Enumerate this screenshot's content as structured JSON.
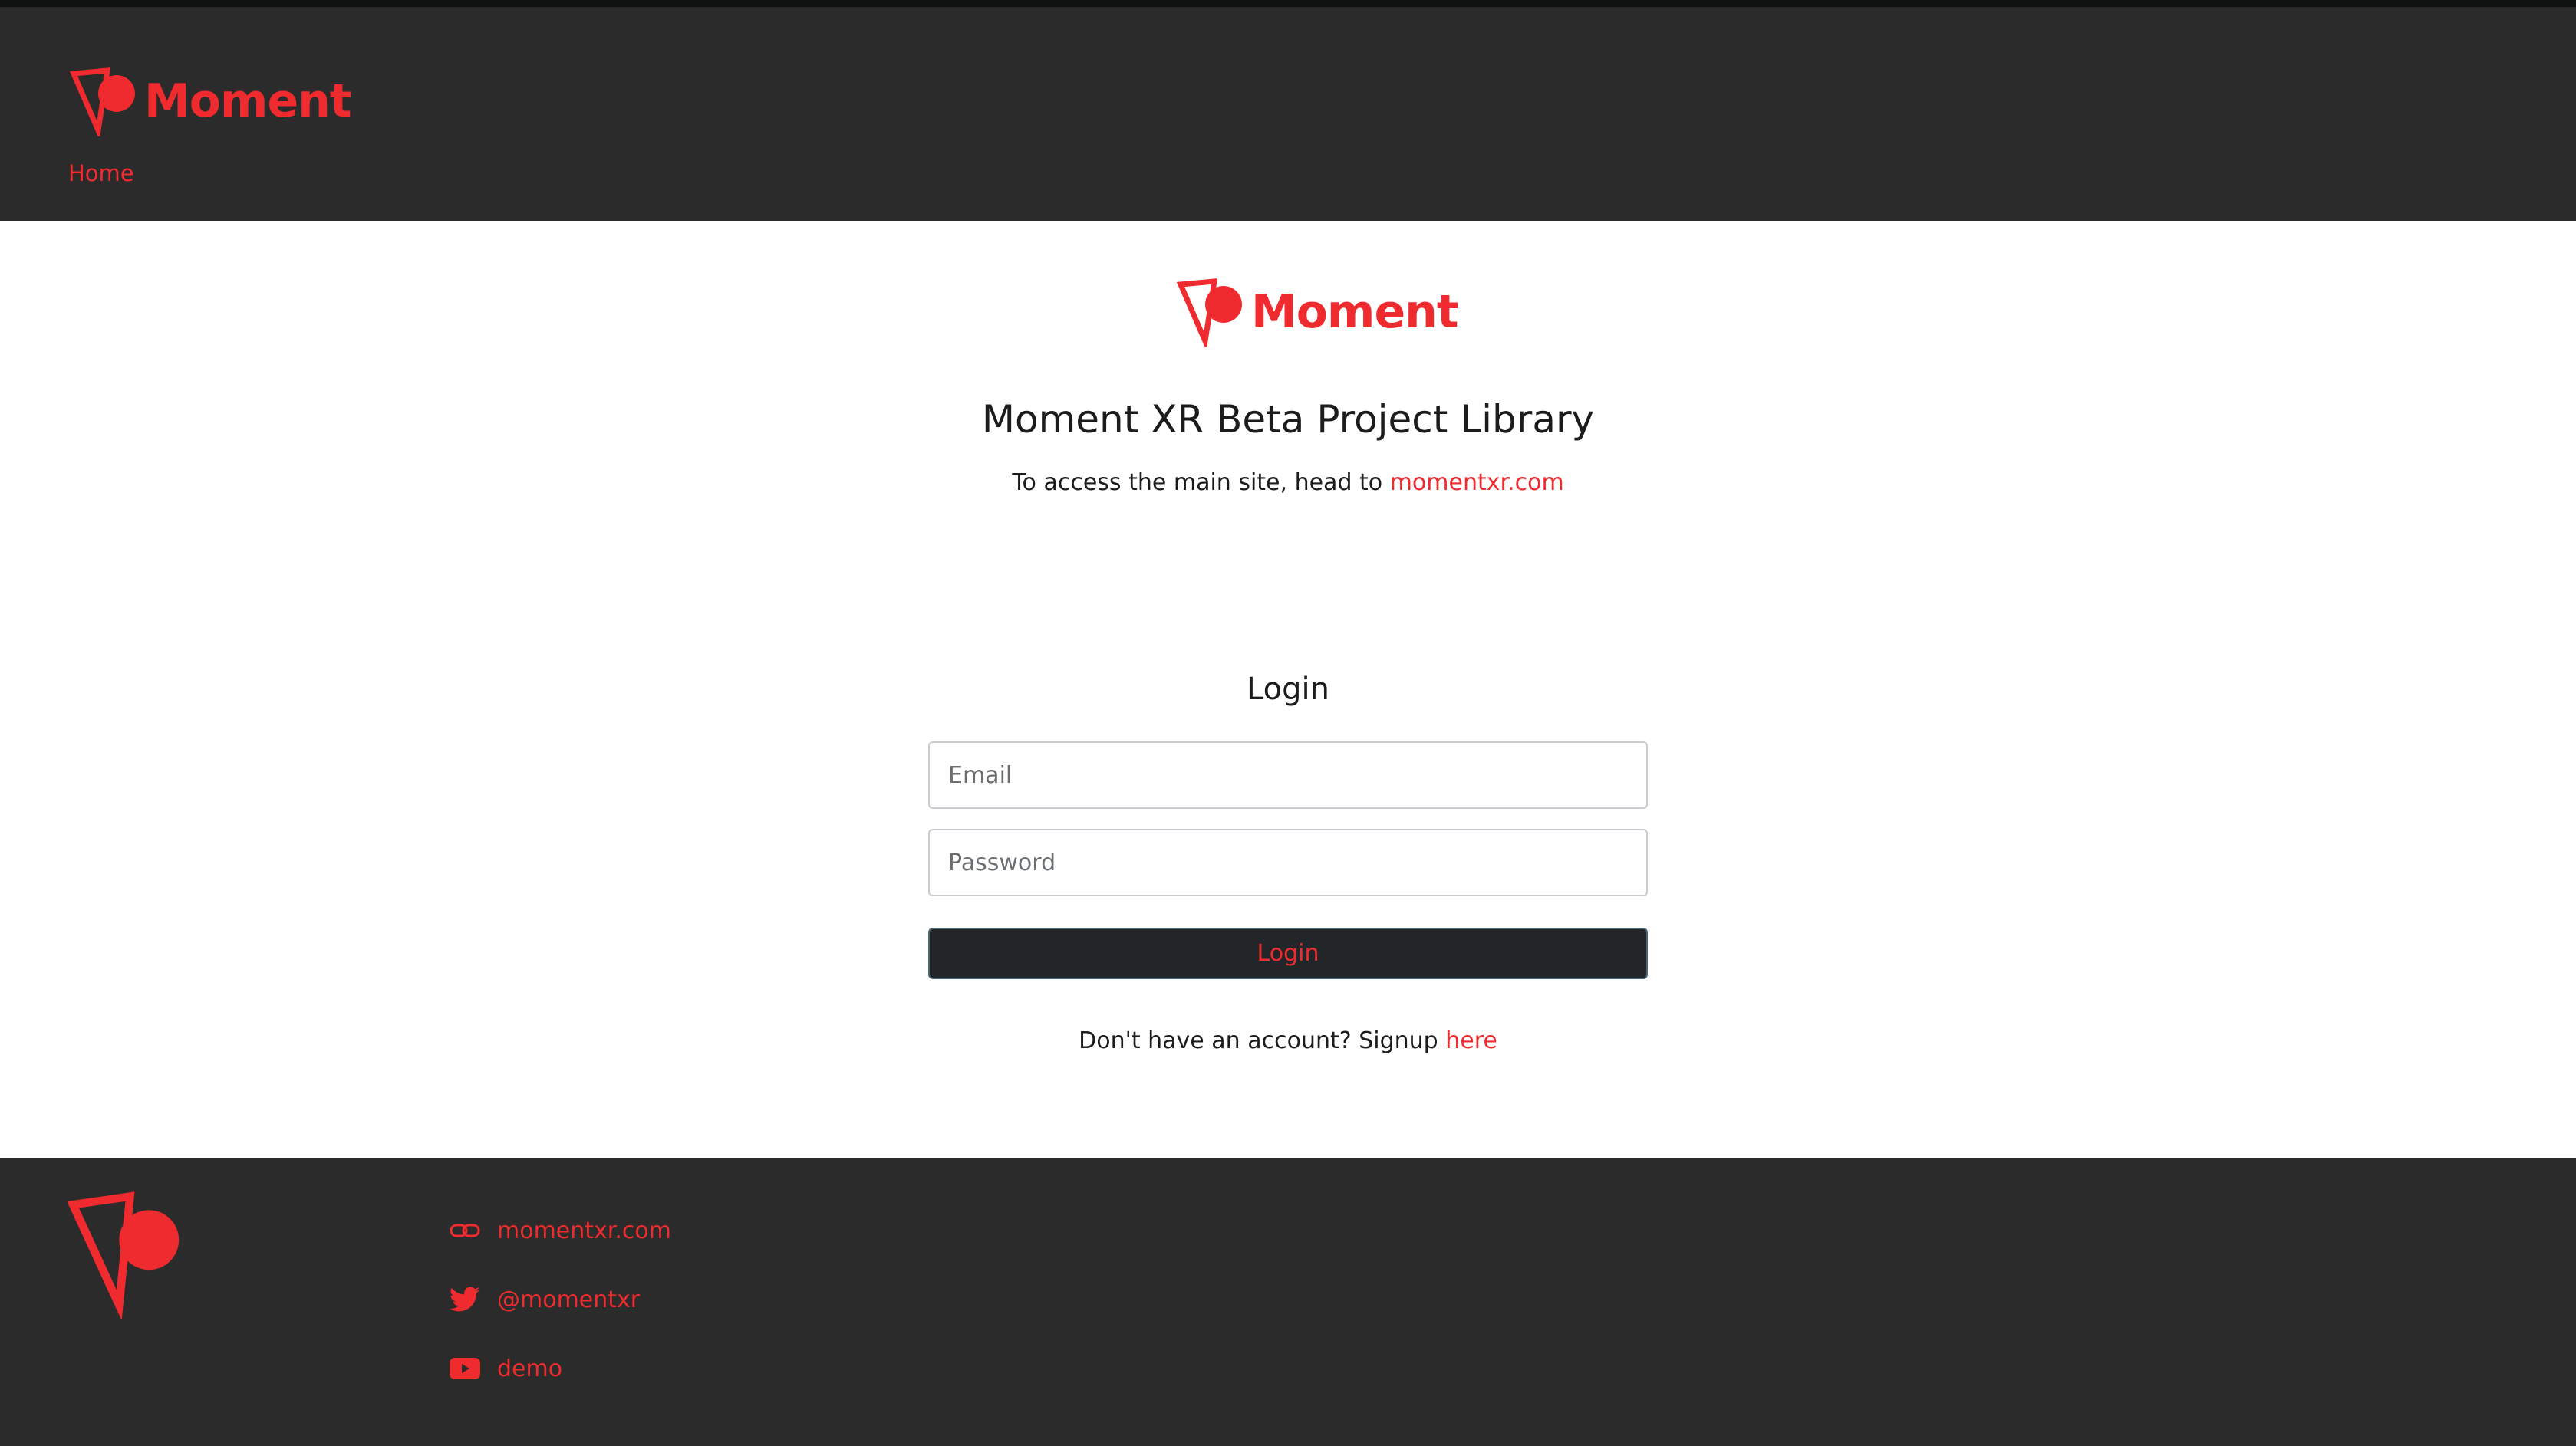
{
  "header": {
    "brand": "Moment",
    "nav": {
      "home_label": "Home"
    }
  },
  "main": {
    "brand": "Moment",
    "title": "Moment XR Beta Project Library",
    "subtitle_prefix": "To access the main site, head to ",
    "subtitle_link": "momentxr.com",
    "login": {
      "heading": "Login",
      "email_placeholder": "Email",
      "password_placeholder": "Password",
      "submit_label": "Login",
      "signup_prefix": "Don't have an account? Signup ",
      "signup_link": "here"
    }
  },
  "footer": {
    "links": [
      {
        "icon": "link-icon",
        "label": "momentxr.com"
      },
      {
        "icon": "twitter-icon",
        "label": "@momentxr"
      },
      {
        "icon": "youtube-icon",
        "label": "demo"
      }
    ]
  },
  "colors": {
    "accent": "#ef2b2f",
    "header_bg": "#2a2b2a",
    "button_bg": "#232629"
  }
}
